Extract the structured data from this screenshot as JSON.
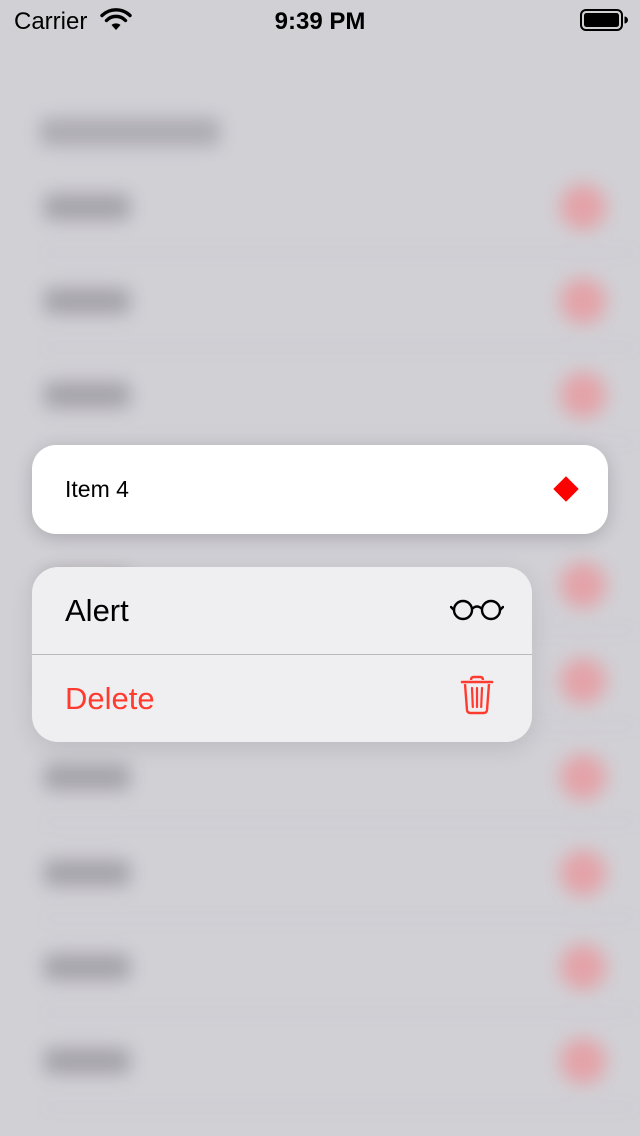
{
  "status_bar": {
    "carrier": "Carrier",
    "time": "9:39 PM",
    "wifi_icon": "wifi-icon",
    "battery_icon": "battery-full-icon"
  },
  "preview": {
    "label": "Item 4",
    "marker_icon": "red-diamond-icon",
    "marker_color": "#ff0000"
  },
  "menu": {
    "items": [
      {
        "label": "Alert",
        "icon": "glasses-icon",
        "color": "#000000"
      },
      {
        "label": "Delete",
        "icon": "trash-icon",
        "color": "#ff3b30"
      }
    ]
  },
  "colors": {
    "background": "#d1d0d5",
    "destructive": "#ff3b30",
    "menu_background": "#efeff2"
  }
}
